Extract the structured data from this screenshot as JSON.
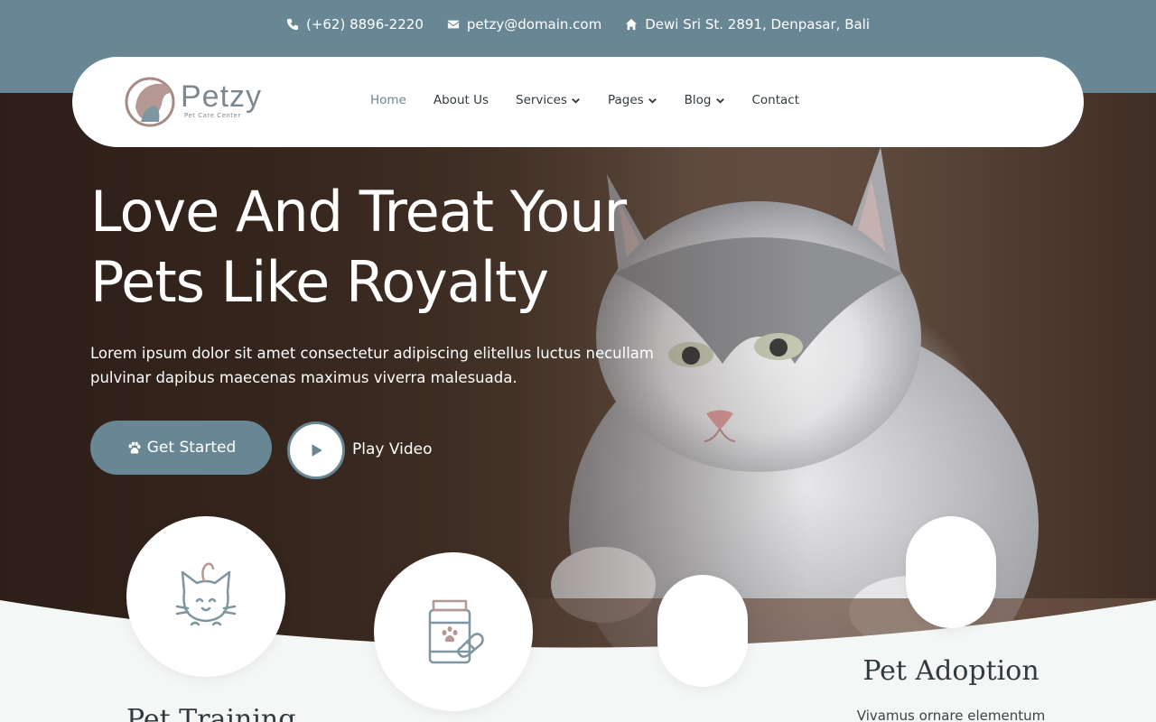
{
  "topbar": {
    "phone": "(+62) 8896-2220",
    "email": "petzy@domain.com",
    "address": "Dewi Sri St. 2891, Denpasar, Bali"
  },
  "brand": {
    "name": "Petzy",
    "tagline": "Pet Care Center"
  },
  "nav": {
    "home": "Home",
    "about": "About Us",
    "services": "Services",
    "pages": "Pages",
    "blog": "Blog",
    "contact": "Contact"
  },
  "hero": {
    "title_line1": "Love And Treat Your",
    "title_line2": "Pets Like Royalty",
    "description": "Lorem ipsum dolor sit amet consectetur adipiscing elitellus luctus necullam pulvinar dapibus maecenas maximus viverra malesuada.",
    "cta_label": "Get Started",
    "video_label": "Play Video"
  },
  "services": {
    "training_title": "Pet Training",
    "adoption_title": "Pet Adoption",
    "adoption_desc": "Vivamus ornare elementum"
  },
  "colors": {
    "accent": "#688693",
    "logo_accent": "#a88a85"
  }
}
